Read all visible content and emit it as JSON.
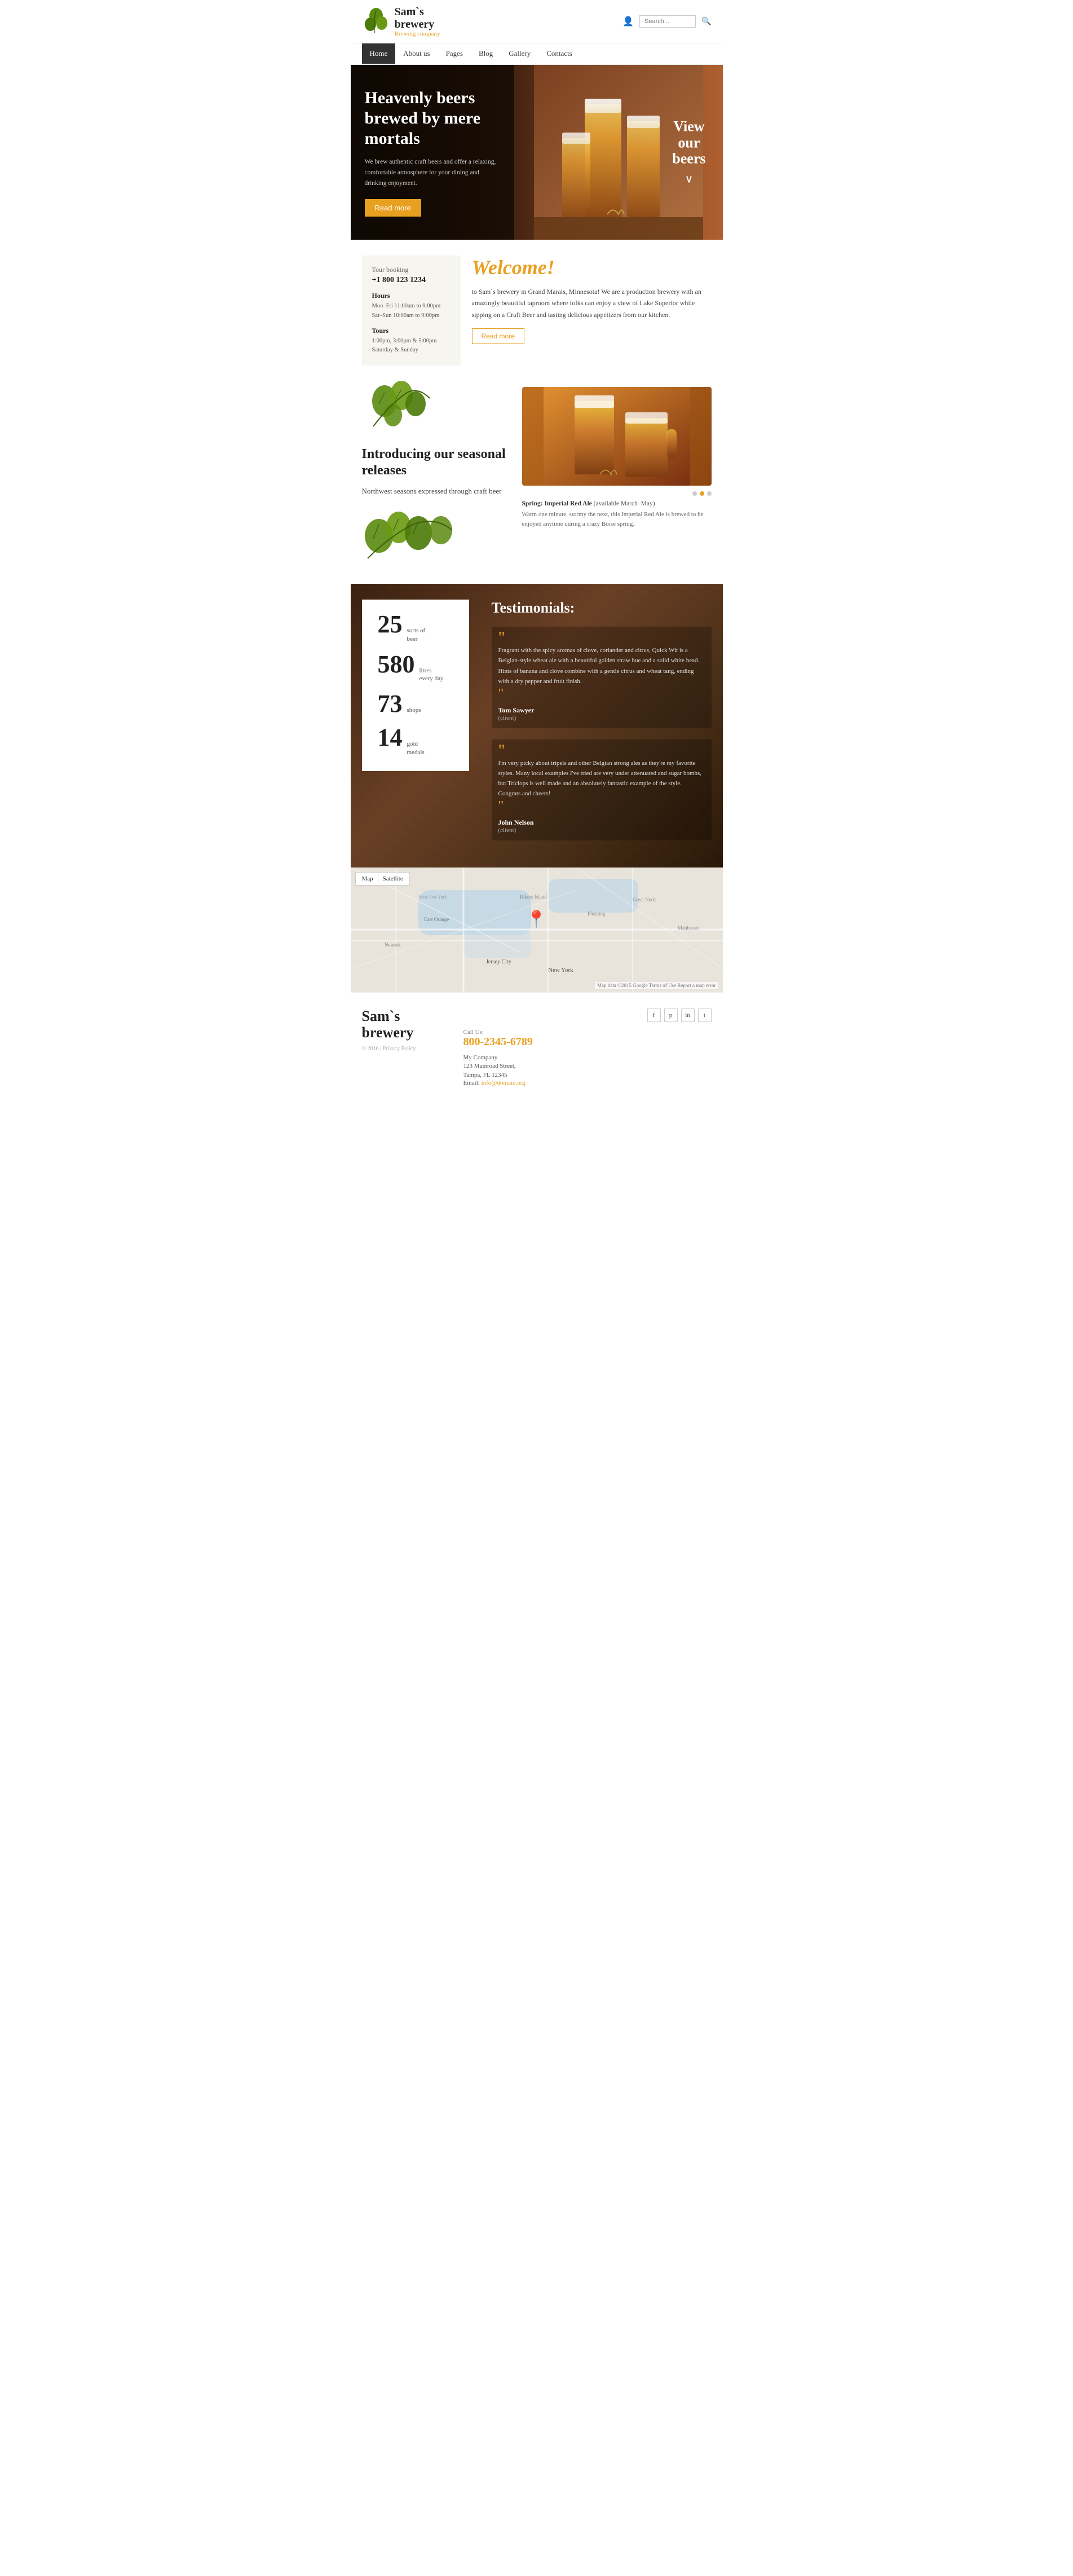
{
  "brand": {
    "name_line1": "Sam`s",
    "name_line2": "brewery",
    "tagline": "Brewing company"
  },
  "header": {
    "search_placeholder": "Search...",
    "account_icon": "👤",
    "search_icon": "🔍"
  },
  "nav": {
    "items": [
      {
        "label": "Home",
        "active": true
      },
      {
        "label": "About us",
        "active": false
      },
      {
        "label": "Pages",
        "active": false
      },
      {
        "label": "Blog",
        "active": false
      },
      {
        "label": "Gallery",
        "active": false
      },
      {
        "label": "Contacts",
        "active": false
      }
    ]
  },
  "hero": {
    "title": "Heavenly beers brewed by mere mortals",
    "description": "We brew authentic craft beers and offer a relaxing, comfortable atmosphere for your dining and drinking enjoyment.",
    "read_more": "Read more",
    "cta_line1": "View",
    "cta_line2": "our",
    "cta_line3": "beers"
  },
  "tour_booking": {
    "label": "Tour booking",
    "phone": "+1 800 123 1234",
    "hours_title": "Hours",
    "hours_weekday": "Mon–Fri 11:00am to 9:00pm",
    "hours_weekend": "Sat–Sun 10:00am to 9:00pm",
    "tours_title": "Tours",
    "tours_times": "1:00pm, 3:00pm & 5:00pm",
    "tours_days": "Saturday & Sunday"
  },
  "welcome": {
    "title": "Welcome!",
    "text": "to Sam`s brewery in Grand Marais, Minnesota! We are a production brewery with an amazingly beautiful taproom where folks can enjoy a view of Lake Superior while sipping on a Craft Beer and tasting delicious appetizers from our kitchen.",
    "read_more": "Read more"
  },
  "seasonal": {
    "title": "Introducing our seasonal releases",
    "subtitle": "Northwest seasons expressed through craft beer",
    "beer_name": "Spring: Imperial Red Ale",
    "beer_availability": "(available March–May)",
    "beer_description": "Warm one minute, stormy the next, this Imperial Red Ale is brewed to be enjoyed anytime during a crazy Boise spring."
  },
  "stats": [
    {
      "number": "25",
      "label_line1": "sorts of",
      "label_line2": "beer"
    },
    {
      "number": "580",
      "label_line1": "litres",
      "label_line2": "every day"
    },
    {
      "number": "73",
      "label_line1": "shops",
      "label_line2": ""
    },
    {
      "number": "14",
      "label_line1": "gold",
      "label_line2": "medals"
    }
  ],
  "testimonials": {
    "title": "Testimonials:",
    "items": [
      {
        "text": "Fragrant with the spicy aromas of clove, coriander and citrus, Quick Wit is a Belgian-style wheat ale with a beautiful golden straw hue and a solid white head. Hints of banana and clove combine with a gentle citrus and wheat tang, ending with a dry pepper and fruit finish.",
        "name": "Tom Sawyer",
        "role": "(client)"
      },
      {
        "text": "I'm very picky about tripels and other Belgian strong ales as they're my favorite styles. Many local examples I've tried are very under attenuated and sugar bombs, but Triclops is well made and an absolutely fantastic example of the style. Congrats and cheers!",
        "name": "John Nelson",
        "role": "(client)"
      }
    ]
  },
  "map": {
    "controls": [
      "Map",
      "Satellite"
    ],
    "label": "Map data ©2015 Google  Terms of Use  Report a map error"
  },
  "footer": {
    "brand_line1": "Sam`s",
    "brand_line2": "brewery",
    "copyright": "© 2016 | Privacy Policy",
    "call_label": "Call Us:",
    "phone": "800-2345-6789",
    "company_label": "My Company",
    "address": "123 Mainroad Street,",
    "city": "Tampa, FL 12345",
    "email_label": "Email:",
    "email": "info@domain.org",
    "social_icons": [
      "f",
      "p",
      "in",
      "t"
    ]
  },
  "colors": {
    "accent": "#e8a020",
    "dark": "#222222",
    "muted": "#888888"
  }
}
